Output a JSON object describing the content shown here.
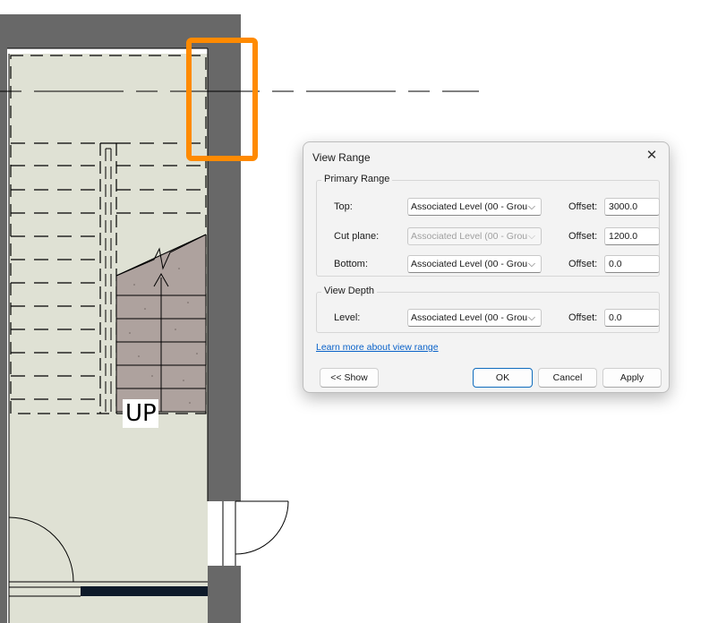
{
  "plan": {
    "stair_label": "UP",
    "highlight_color": "#ff8a00",
    "wall_color": "#686868",
    "floor_color": "#dfe1d4",
    "stair_color": "#aea29e"
  },
  "dialog": {
    "title": "View Range",
    "close_icon": "close-icon",
    "primary_range": {
      "title": "Primary Range",
      "rows": [
        {
          "label": "Top:",
          "level": "Associated Level (00 - Grou",
          "offset_label": "Offset:",
          "offset": "3000.0",
          "disabled": false
        },
        {
          "label": "Cut plane:",
          "level": "Associated Level (00 - Grou",
          "offset_label": "Offset:",
          "offset": "1200.0",
          "disabled": true
        },
        {
          "label": "Bottom:",
          "level": "Associated Level (00 - Grou",
          "offset_label": "Offset:",
          "offset": "0.0",
          "disabled": false
        }
      ]
    },
    "view_depth": {
      "title": "View Depth",
      "row": {
        "label": "Level:",
        "level": "Associated Level (00 - Grou",
        "offset_label": "Offset:",
        "offset": "0.0"
      }
    },
    "learn_more": "Learn more about view range",
    "buttons": {
      "show": "<< Show",
      "ok": "OK",
      "cancel": "Cancel",
      "apply": "Apply"
    }
  }
}
